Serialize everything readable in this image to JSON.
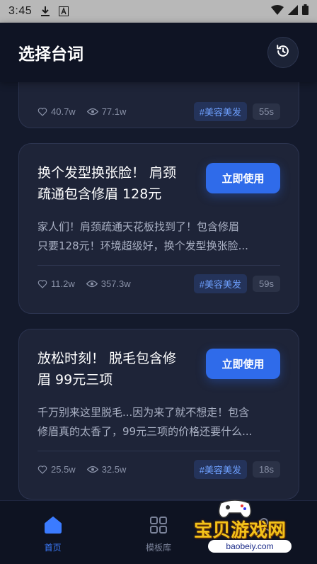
{
  "status_bar": {
    "time": "3:45"
  },
  "header": {
    "title": "选择台词"
  },
  "cards": [
    {
      "likes": "40.7w",
      "views": "77.1w",
      "tag": "#美容美发",
      "duration": "55s"
    },
    {
      "title_line1": "换个发型换张脸！ 肩颈",
      "title_line2": "疏通包含修眉 128元",
      "button": "立即使用",
      "desc_line1": "家人们！肩颈疏通天花板找到了！包含修眉",
      "desc_line2": "只要128元！环境超级好，换个发型换张脸...",
      "likes": "11.2w",
      "views": "357.3w",
      "tag": "#美容美发",
      "duration": "59s"
    },
    {
      "title_line1": "放松时刻！ 脱毛包含修",
      "title_line2": "眉 99元三项",
      "button": "立即使用",
      "desc_line1": "千万别来这里脱毛...因为来了就不想走！包含",
      "desc_line2": "修眉真的太香了，99元三项的价格还要什么...",
      "likes": "25.5w",
      "views": "32.5w",
      "tag": "#美容美发",
      "duration": "18s"
    }
  ],
  "nav": {
    "home": "首页",
    "templates": "模板库"
  },
  "watermark": {
    "text": "宝贝游戏网",
    "url": "baobeiy.com"
  },
  "colors": {
    "accent": "#2f6bea",
    "background": "#141a2c",
    "card": "#1e2438",
    "tag_text": "#6ea0ff"
  }
}
